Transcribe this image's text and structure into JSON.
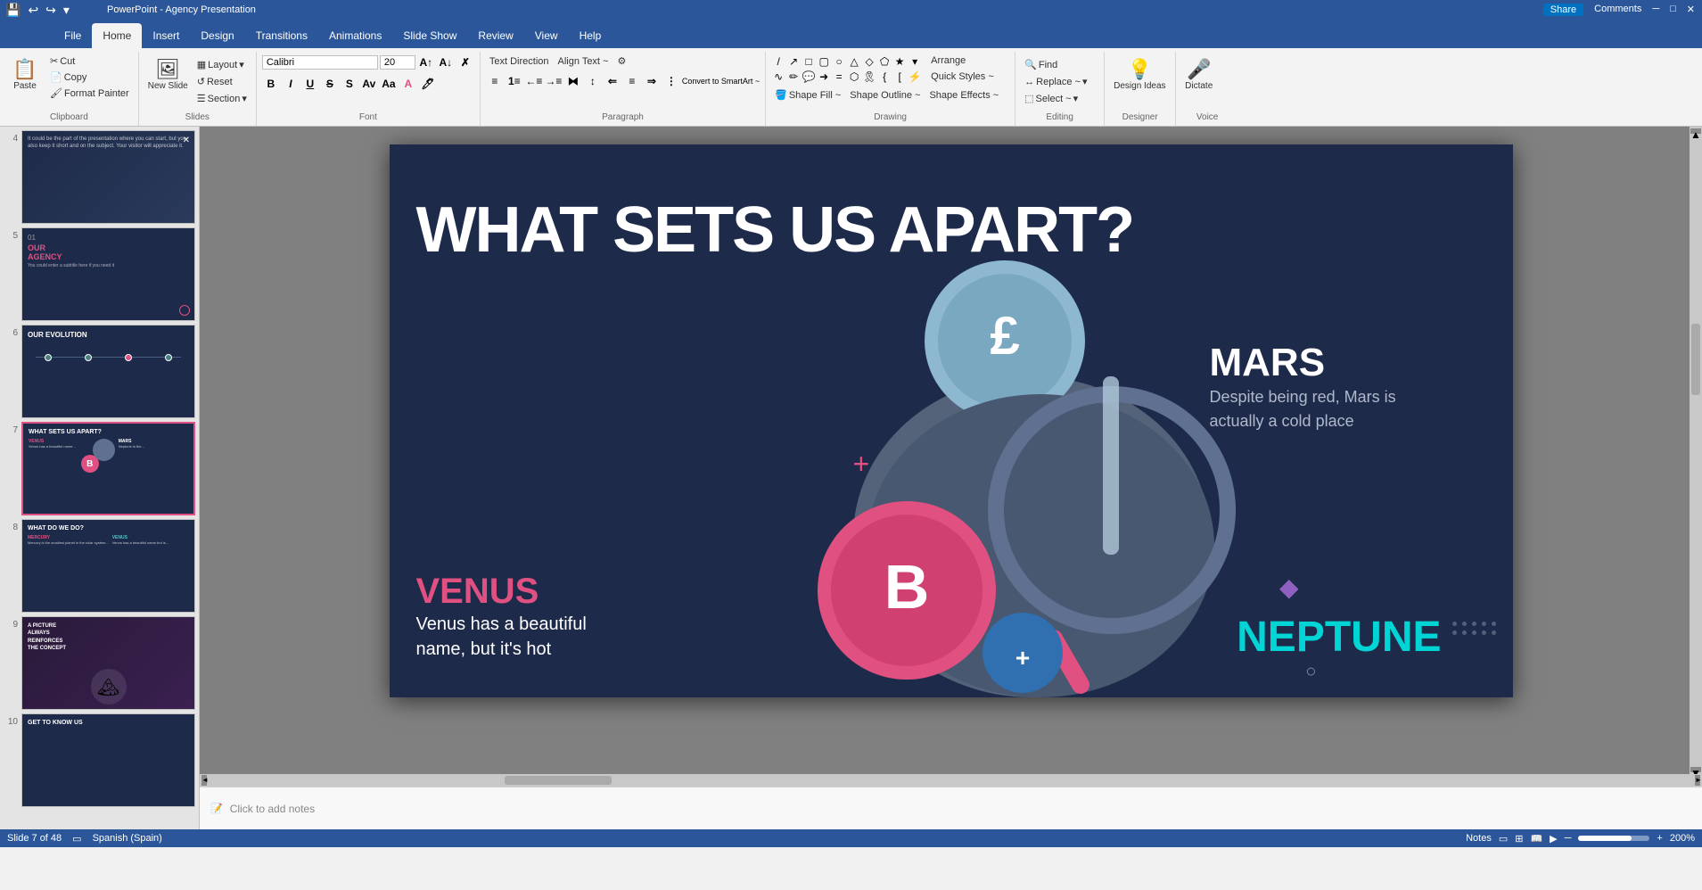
{
  "titlebar": {
    "title": "PowerPoint - Agency Presentation",
    "share_label": "Share",
    "comments_label": "Comments",
    "share_icon": "👤",
    "comments_icon": "💬"
  },
  "ribbon": {
    "tabs": [
      "File",
      "Home",
      "Insert",
      "Design",
      "Transitions",
      "Animations",
      "Slide Show",
      "Review",
      "View",
      "Help"
    ],
    "active_tab": "Home",
    "groups": {
      "clipboard": {
        "label": "Clipboard",
        "paste_label": "Paste",
        "cut_label": "Cut",
        "copy_label": "Copy",
        "format_painter_label": "Format Painter"
      },
      "slides": {
        "label": "Slides",
        "new_slide_label": "New Slide",
        "layout_label": "Layout",
        "reset_label": "Reset",
        "section_label": "Section"
      },
      "font": {
        "label": "Font",
        "font_name": "Calibri",
        "font_size": "20",
        "bold": "B",
        "italic": "I",
        "underline": "U",
        "strikethrough": "S",
        "shadow": "S"
      },
      "paragraph": {
        "label": "Paragraph",
        "align_text_label": "Align Text ~",
        "convert_smartart_label": "Convert to SmartArt ~",
        "text_direction_label": "Text Direction"
      },
      "drawing": {
        "label": "Drawing",
        "arrange_label": "Arrange",
        "quick_styles_label": "Quick Styles ~",
        "shape_fill_label": "Shape Fill ~",
        "shape_outline_label": "Shape Outline ~",
        "shape_effects_label": "Shape Effects ~"
      },
      "editing": {
        "label": "Editing",
        "find_label": "Find",
        "replace_label": "Replace ~",
        "select_label": "Select ~"
      },
      "designer": {
        "label": "Designer",
        "design_ideas_label": "Design Ideas"
      },
      "voice": {
        "label": "Voice",
        "dictate_label": "Dictate"
      }
    }
  },
  "slides": [
    {
      "number": "4",
      "bg_color": "#1e2a4a",
      "label": "slide-4",
      "active": false
    },
    {
      "number": "5",
      "bg_color": "#1e2a4a",
      "label": "slide-5-our-agency",
      "title": "OUR AGENCY",
      "active": false
    },
    {
      "number": "6",
      "bg_color": "#1e2a4a",
      "label": "slide-6-evolution",
      "title": "OUR EVOLUTION",
      "active": false
    },
    {
      "number": "7",
      "bg_color": "#1e2a4a",
      "label": "slide-7-what-sets-us-apart",
      "title": "WHAT SETS US APART?",
      "active": true
    },
    {
      "number": "8",
      "bg_color": "#1e2a4a",
      "label": "slide-8-what-do-we-do",
      "title": "WHAT DO WE DO?",
      "active": false
    },
    {
      "number": "9",
      "bg_color": "#2a1a3a",
      "label": "slide-9-picture",
      "active": false
    },
    {
      "number": "10",
      "bg_color": "#1e2a4a",
      "label": "slide-10-get-to-know-us",
      "active": false
    }
  ],
  "main_slide": {
    "bg_color": "#1e2a4a",
    "title": "WHAT SETS US APART?",
    "venus": {
      "name": "VENUS",
      "description": "Venus has a beautiful name, but it's hot"
    },
    "mars": {
      "name": "MARS",
      "description": "Despite being red, Mars is actually a cold place"
    },
    "neptune": {
      "name": "NEPTUNE"
    }
  },
  "notes": {
    "placeholder": "Click to add notes"
  },
  "status": {
    "slide_info": "Slide 7 of 48",
    "language": "Spanish (Spain)",
    "notes_label": "Notes",
    "zoom_level": "200%"
  }
}
